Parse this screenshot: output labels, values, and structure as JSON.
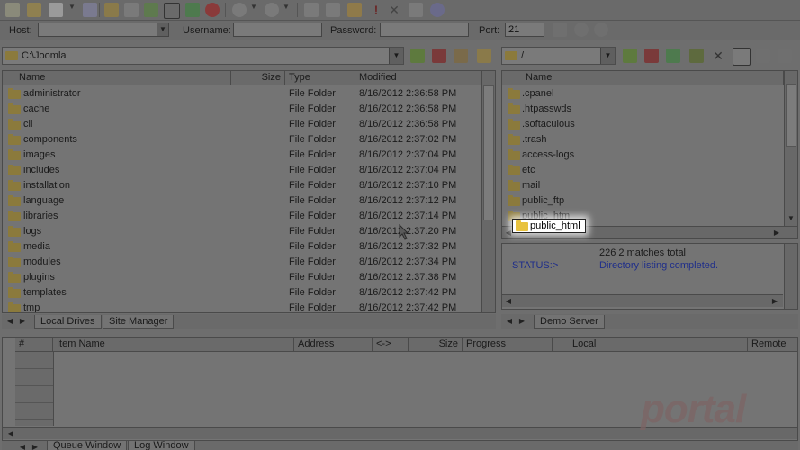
{
  "quickconnect": {
    "host_label": "Host:",
    "host_value": "",
    "username_label": "Username:",
    "username_value": "",
    "password_label": "Password:",
    "password_value": "",
    "port_label": "Port:",
    "port_value": "21"
  },
  "local": {
    "path": "C:\\Joomla",
    "columns": [
      "Name",
      "Size",
      "Type",
      "Modified"
    ],
    "rows": [
      {
        "name": "administrator",
        "type": "File Folder",
        "modified": "8/16/2012 2:36:58 PM"
      },
      {
        "name": "cache",
        "type": "File Folder",
        "modified": "8/16/2012 2:36:58 PM"
      },
      {
        "name": "cli",
        "type": "File Folder",
        "modified": "8/16/2012 2:36:58 PM"
      },
      {
        "name": "components",
        "type": "File Folder",
        "modified": "8/16/2012 2:37:02 PM"
      },
      {
        "name": "images",
        "type": "File Folder",
        "modified": "8/16/2012 2:37:04 PM"
      },
      {
        "name": "includes",
        "type": "File Folder",
        "modified": "8/16/2012 2:37:04 PM"
      },
      {
        "name": "installation",
        "type": "File Folder",
        "modified": "8/16/2012 2:37:10 PM"
      },
      {
        "name": "language",
        "type": "File Folder",
        "modified": "8/16/2012 2:37:12 PM"
      },
      {
        "name": "libraries",
        "type": "File Folder",
        "modified": "8/16/2012 2:37:14 PM"
      },
      {
        "name": "logs",
        "type": "File Folder",
        "modified": "8/16/2012 2:37:20 PM"
      },
      {
        "name": "media",
        "type": "File Folder",
        "modified": "8/16/2012 2:37:32 PM"
      },
      {
        "name": "modules",
        "type": "File Folder",
        "modified": "8/16/2012 2:37:34 PM"
      },
      {
        "name": "plugins",
        "type": "File Folder",
        "modified": "8/16/2012 2:37:38 PM"
      },
      {
        "name": "templates",
        "type": "File Folder",
        "modified": "8/16/2012 2:37:42 PM"
      },
      {
        "name": "tmp",
        "type": "File Folder",
        "modified": "8/16/2012 2:37:42 PM"
      }
    ],
    "tabs": [
      "Local Drives",
      "Site Manager"
    ]
  },
  "remote": {
    "path": "/",
    "columns": [
      "Name"
    ],
    "rows": [
      ".cpanel",
      ".htpasswds",
      ".softaculous",
      ".trash",
      "access-logs",
      "etc",
      "mail",
      "public_ftp",
      "public_html"
    ],
    "tabs": [
      "Demo Server"
    ],
    "status": {
      "line1": "226 2 matches total",
      "label": "STATUS:>",
      "line2": "Directory listing completed."
    }
  },
  "drag_tooltip": "public_html",
  "queue": {
    "columns": [
      "#",
      "Item Name",
      "Address",
      "<->",
      "Size",
      "Progress",
      "Local",
      "Remote"
    ],
    "tabs": [
      "Queue Window",
      "Log Window"
    ]
  },
  "watermark": "portal",
  "colors": {
    "folder": "#e8c23f",
    "status_blue": "#1f2e8a",
    "dim_overlay": "#6e6e6e"
  }
}
